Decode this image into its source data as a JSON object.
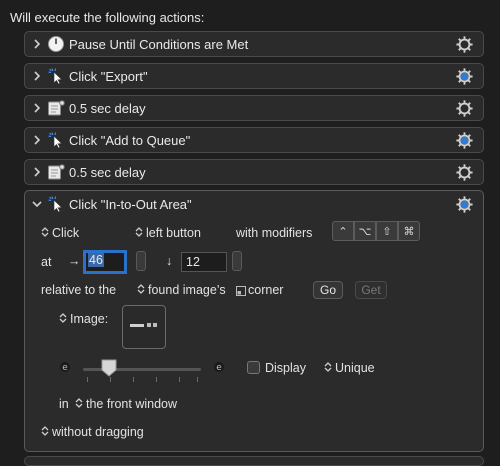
{
  "header": {
    "title": "Will execute the following actions:"
  },
  "actions": [
    {
      "title": "Pause Until Conditions are Met",
      "icon": "stopwatch-icon",
      "gear_active": false
    },
    {
      "title": "Click \"Export\"",
      "icon": "click-cursor-icon",
      "gear_active": true
    },
    {
      "title": "0.5 sec delay",
      "icon": "delay-icon",
      "gear_active": false
    },
    {
      "title": "Click \"Add to Queue\"",
      "icon": "click-cursor-icon",
      "gear_active": true
    },
    {
      "title": "0.5 sec delay",
      "icon": "delay-icon",
      "gear_active": false
    }
  ],
  "expanded": {
    "title": "Click \"In-to-Out Area\"",
    "click_type": "Click",
    "button": "left button",
    "with_modifiers": "with modifiers",
    "modifiers": [
      "⌃",
      "⌥",
      "⇧",
      "⌘"
    ],
    "at_label": "at",
    "x_arrow": "→",
    "x_value": "46",
    "y_arrow": "↓",
    "y_value": "12",
    "relative_label": "relative to the",
    "relative_target": "found image’s",
    "corner_label": "corner",
    "go_label": "Go",
    "get_label": "Get",
    "image_label": "Image:",
    "display_label": "Display",
    "unique_label": "Unique",
    "in_label": "in",
    "window_target": "the front window",
    "dragging_label": "without dragging",
    "colors": {
      "accent": "#2a72c9",
      "gear_active": "#2f7bd6"
    }
  }
}
